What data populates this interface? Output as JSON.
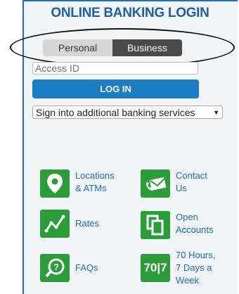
{
  "header": {
    "title": "ONLINE BANKING LOGIN"
  },
  "toggle": {
    "personal": "Personal",
    "business": "Business",
    "selected": "Business"
  },
  "form": {
    "access_placeholder": "Access ID",
    "login_label": "LOG IN",
    "services_selected": "Sign into additional banking services"
  },
  "colors": {
    "accent": "#1b7ec4",
    "title": "#1f5fa6",
    "tile_green": "#2a9d38"
  },
  "links": [
    {
      "icon": "location-pin-icon",
      "lines": [
        "Locations",
        "& ATMs"
      ]
    },
    {
      "icon": "envelope-icon",
      "lines": [
        "Contact",
        "Us"
      ]
    },
    {
      "icon": "rates-chart-icon",
      "lines": [
        "Rates"
      ]
    },
    {
      "icon": "documents-icon",
      "lines": [
        "Open",
        "Accounts"
      ]
    },
    {
      "icon": "faq-icon",
      "lines": [
        "FAQs"
      ]
    },
    {
      "icon": "hours-icon",
      "icon_text": "70|7",
      "lines": [
        "70 Hours,",
        "7 Days a",
        "Week"
      ]
    }
  ]
}
